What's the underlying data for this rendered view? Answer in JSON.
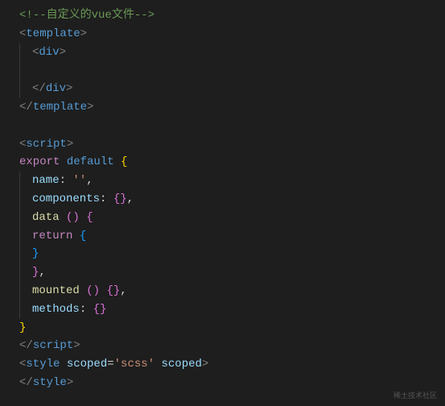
{
  "code": {
    "comment_open": "<!--",
    "comment_text": "自定义的vue文件",
    "comment_close": "-->",
    "template": "template",
    "div": "div",
    "script": "script",
    "style": "style",
    "export": "export",
    "default": "default",
    "name_key": "name",
    "name_value": "''",
    "components_key": "components",
    "data_key": "data",
    "return": "return",
    "mounted_key": "mounted",
    "methods_key": "methods",
    "scoped_attr": "scoped",
    "scoped_value": "'scss'",
    "lt": "<",
    "gt": ">",
    "lt_slash": "</",
    "colon": ":",
    "comma": ",",
    "space": " ",
    "eq": "=",
    "lbrace": "{",
    "rbrace": "}",
    "lparen": "(",
    "rparen": ")",
    "empty_braces": "{}"
  },
  "watermark": "稀土技术社区"
}
